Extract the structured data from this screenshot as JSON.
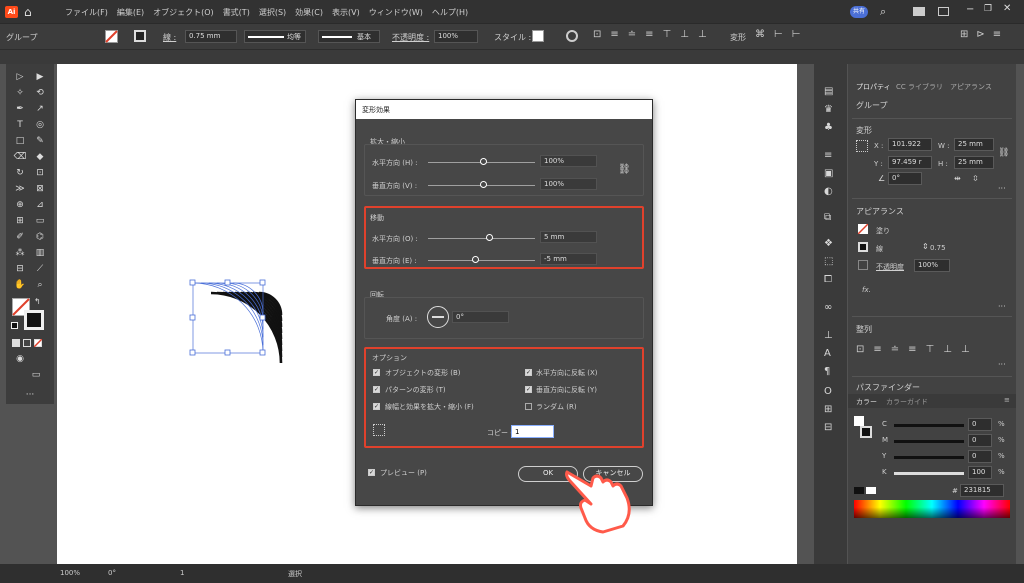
{
  "menubar": {
    "items": [
      "ファイル(F)",
      "編集(E)",
      "オブジェクト(O)",
      "書式(T)",
      "選択(S)",
      "効果(C)",
      "表示(V)",
      "ウィンドウ(W)",
      "ヘルプ(H)"
    ],
    "share_label": "共有",
    "logo": "Ai",
    "home_icon": "home-icon",
    "right_icons": [
      "search-icon",
      "workspace-icon",
      "window-icon",
      "minimize-icon",
      "restore-icon",
      "close-icon"
    ]
  },
  "control_bar": {
    "selection_label": "グループ",
    "stroke_label": "線 :",
    "stroke_weight": "0.75 mm",
    "stroke_profile": "均等",
    "brush_label": "基本",
    "opacity_label": "不透明度 :",
    "opacity_value": "100%",
    "style_label": "スタイル :",
    "transform_label": "変形"
  },
  "dialog": {
    "title": "変形効果",
    "scale": {
      "heading": "拡大・縮小",
      "horizontal_label": "水平方向 (H) :",
      "horizontal_value": "100%",
      "vertical_label": "垂直方向 (V) :",
      "vertical_value": "100%"
    },
    "move": {
      "heading": "移動",
      "horizontal_label": "水平方向 (O) :",
      "horizontal_value": "5 mm",
      "vertical_label": "垂直方向 (E) :",
      "vertical_value": "-5 mm"
    },
    "rotate": {
      "heading": "回転",
      "angle_label": "角度 (A) :",
      "angle_value": "0°"
    },
    "options": {
      "heading": "オプション",
      "transform_objects": "オブジェクトの変形 (B)",
      "transform_patterns": "パターンの変形 (T)",
      "scale_strokes": "線幅と効果を拡大・縮小 (F)",
      "reflect_x": "水平方向に反転 (X)",
      "reflect_y": "垂直方向に反転 (Y)",
      "random": "ランダム (R)",
      "copies_label": "コピー (S)",
      "copies_value": "1"
    },
    "preview_label": "プレビュー (P)",
    "ok_label": "OK",
    "cancel_label": "キャンセル"
  },
  "properties_panel": {
    "tabs": [
      "プロパティ",
      "CC ライブラリ",
      "アピアランス"
    ],
    "group_label": "グループ",
    "transform_heading": "変形",
    "x_label": "X :",
    "x_value": "101.922",
    "y_label": "Y :",
    "y_value": "97.459 r",
    "w_label": "W :",
    "w_value": "25 mm",
    "h_label": "H :",
    "h_value": "25 mm",
    "angle_value": "0°",
    "appearance_heading": "アピアランス",
    "fill_label": "塗り",
    "stroke_label": "線",
    "stroke_value": "0.75",
    "opacity_label": "不透明度",
    "opacity_value": "100%",
    "fx_label": "fx.",
    "align_heading": "整列",
    "pathfinder_heading": "パスファインダー"
  },
  "color_panel": {
    "tabs": [
      "カラー",
      "カラーガイド"
    ],
    "c_label": "C",
    "c_value": "0",
    "m_label": "M",
    "m_value": "0",
    "y_label": "Y",
    "y_value": "0",
    "k_label": "K",
    "k_value": "100",
    "pct": "%",
    "hex_prefix": "#",
    "hex_value": "231815"
  },
  "status_bar": {
    "zoom": "100%",
    "rotation": "0°",
    "artboard": "1",
    "tool": "選択"
  },
  "colors": {
    "highlight": "#e0412c",
    "accent": "#ff4b1a",
    "hand": "#ff5a4a"
  }
}
